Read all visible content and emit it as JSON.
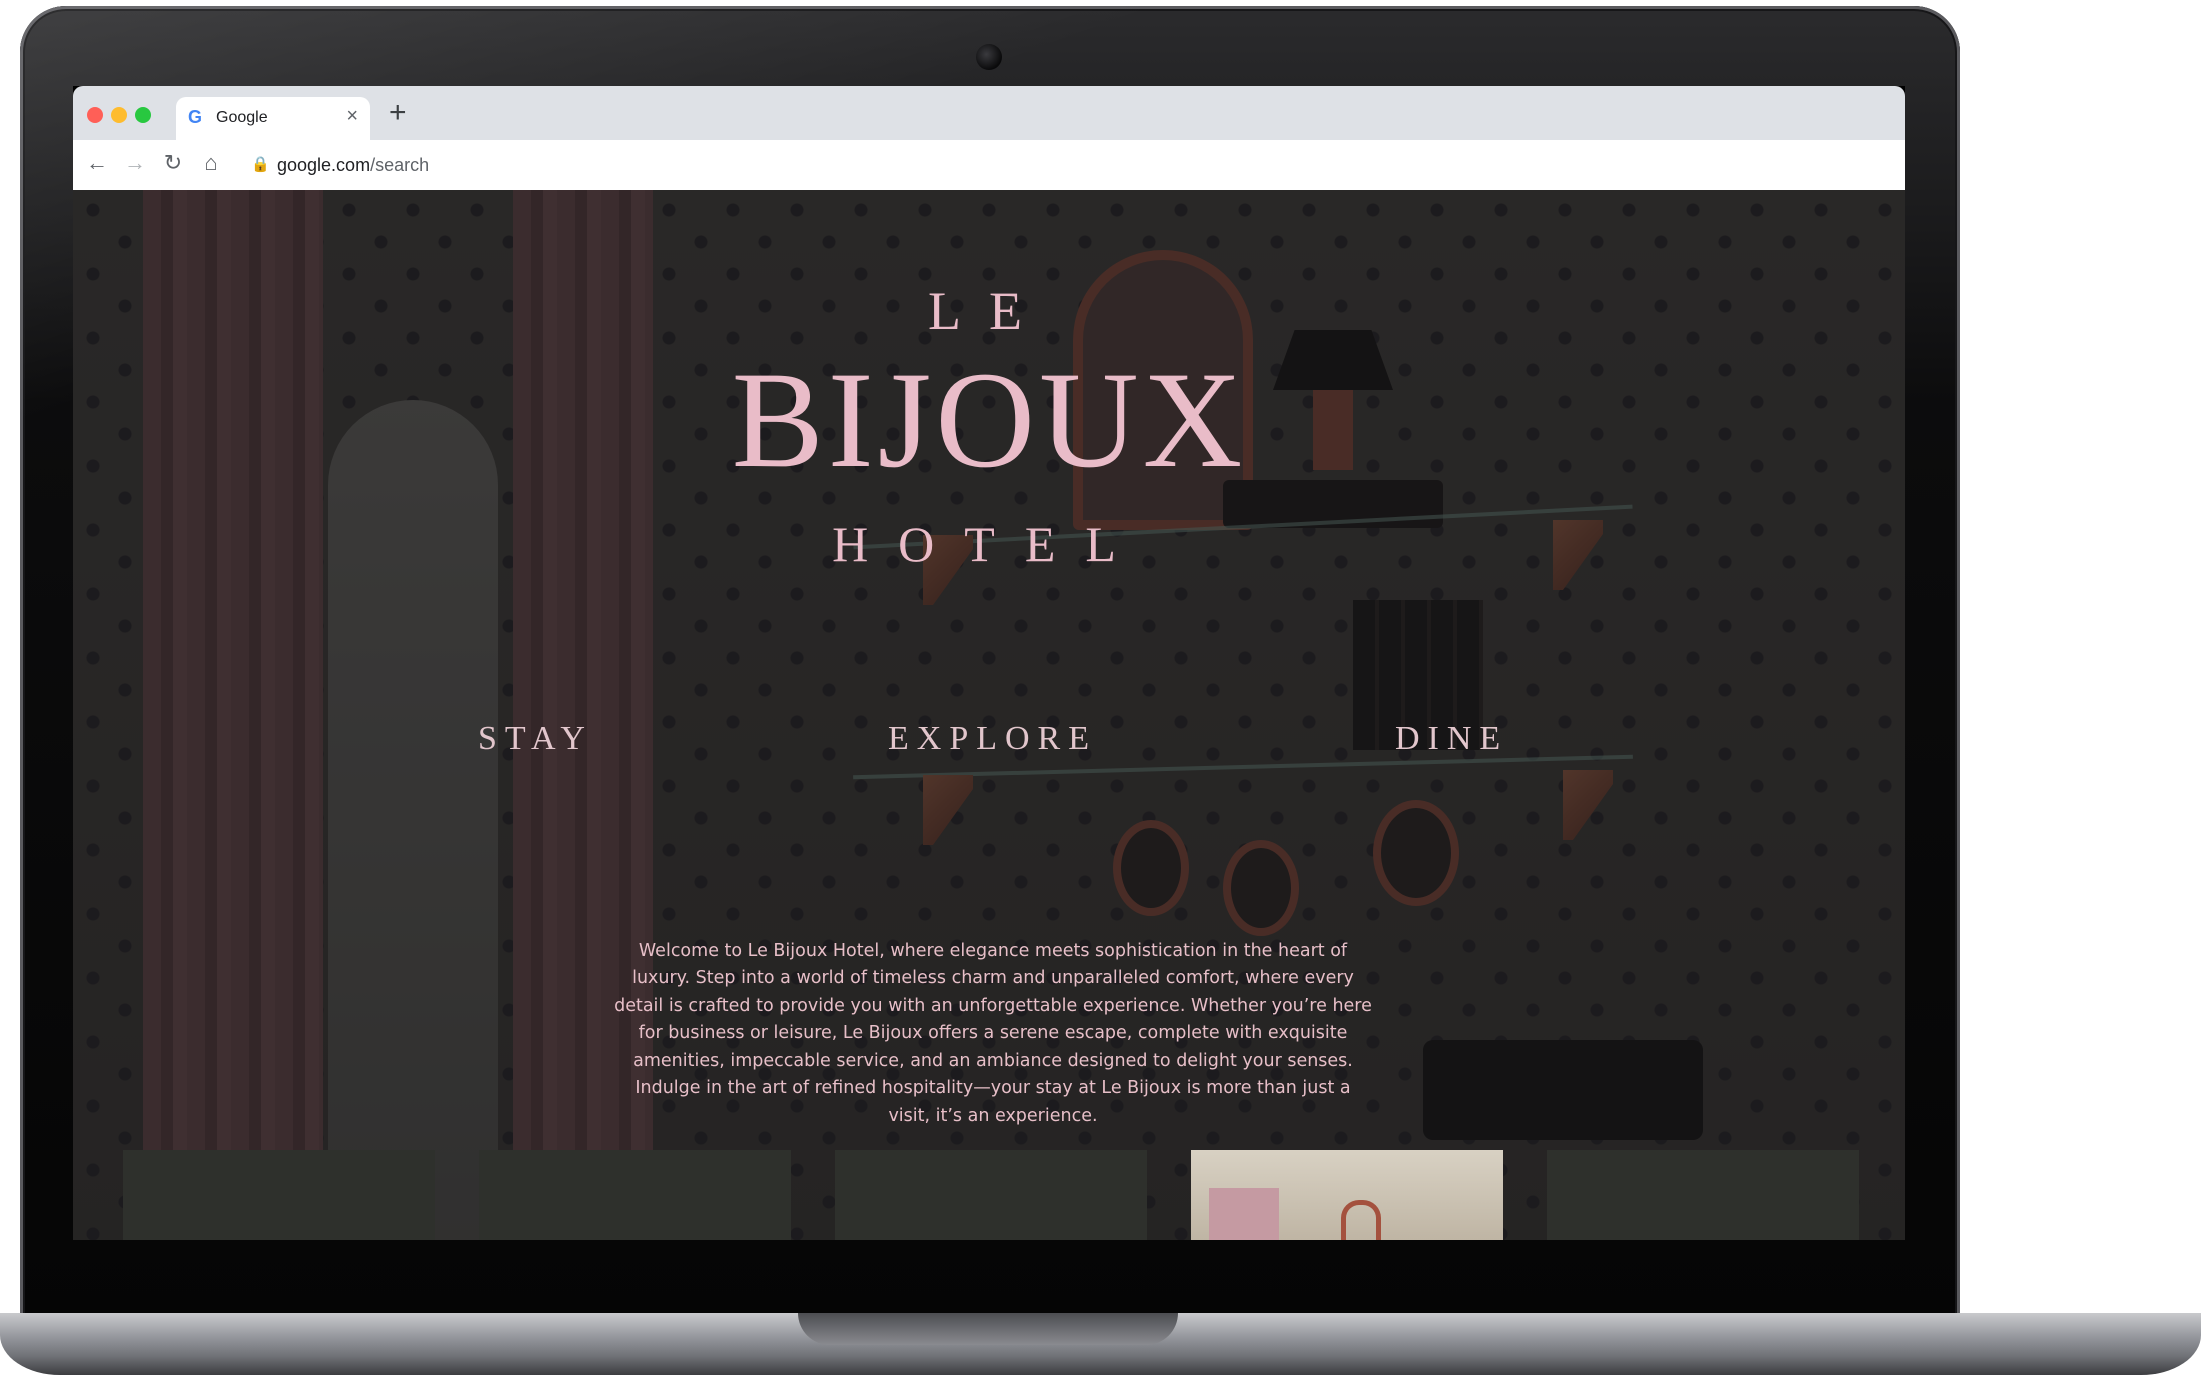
{
  "browser": {
    "tab_title": "Google",
    "tab_favicon": "G",
    "url_domain": "google.com",
    "url_path": "/search",
    "icons": {
      "back": "←",
      "forward": "→",
      "reload": "↻",
      "home": "⌂",
      "lock": "🔒",
      "star": "☆",
      "menu": "⋮",
      "close": "×",
      "new_tab": "+"
    },
    "traffic_colors": [
      "#ff5f57",
      "#febc2e",
      "#28c840"
    ]
  },
  "site": {
    "logo": {
      "line1": "LE",
      "line2": "BIJOUX",
      "line3": "HOTEL"
    },
    "nav": [
      "STAY",
      "EXPLORE",
      "DINE"
    ],
    "intro": "Welcome to Le Bijoux Hotel, where elegance meets sophistication in the heart of luxury. Step into a world of timeless charm and unparalleled comfort, where every detail is crafted to provide you with an unforgettable experience. Whether you’re here for business or leisure, Le Bijoux offers a serene escape, complete with exquisite amenities, impeccable service, and an ambiance designed to delight your senses. Indulge in the art of refined hospitality—your stay at Le Bijoux is more than just a visit, it’s an experience.",
    "accent_color": "#e9bcc8",
    "thumbnail_count": 5,
    "active_thumbnail": 4
  }
}
